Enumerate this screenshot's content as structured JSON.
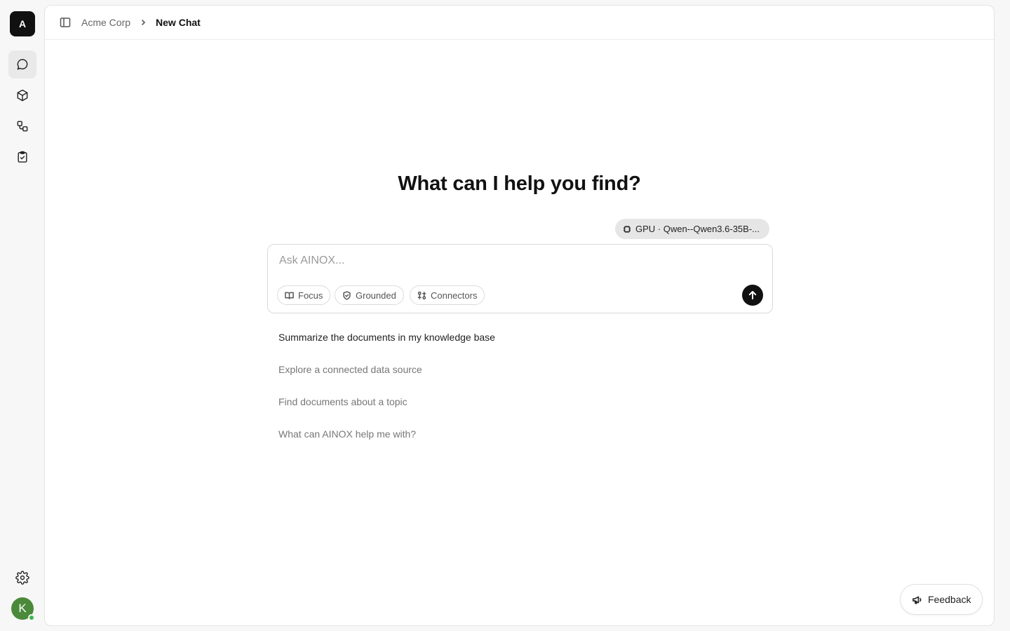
{
  "app": {
    "logo_letter": "A",
    "accent": "#111111"
  },
  "sidebar": {
    "items": [
      {
        "icon": "chat-bubble-icon",
        "active": true
      },
      {
        "icon": "cube-icon",
        "active": false
      },
      {
        "icon": "workflow-icon",
        "active": false
      },
      {
        "icon": "clipboard-check-icon",
        "active": false
      }
    ],
    "settings_icon": "gear-icon",
    "user_initial": "K",
    "user_status_color": "#3bb84a"
  },
  "header": {
    "workspace": "Acme Corp",
    "current": "New Chat"
  },
  "main": {
    "heading": "What can I help you find?",
    "model_label": "GPU · Qwen--Qwen3.6-35B-...",
    "composer": {
      "placeholder": "Ask AINOX...",
      "value": "",
      "chips": [
        "Focus",
        "Grounded",
        "Connectors"
      ]
    },
    "suggestions": [
      "Summarize the documents in my knowledge base",
      "Explore a connected data source",
      "Find documents about a topic",
      "What can AINOX help me with?"
    ]
  },
  "feedback": {
    "label": "Feedback"
  }
}
